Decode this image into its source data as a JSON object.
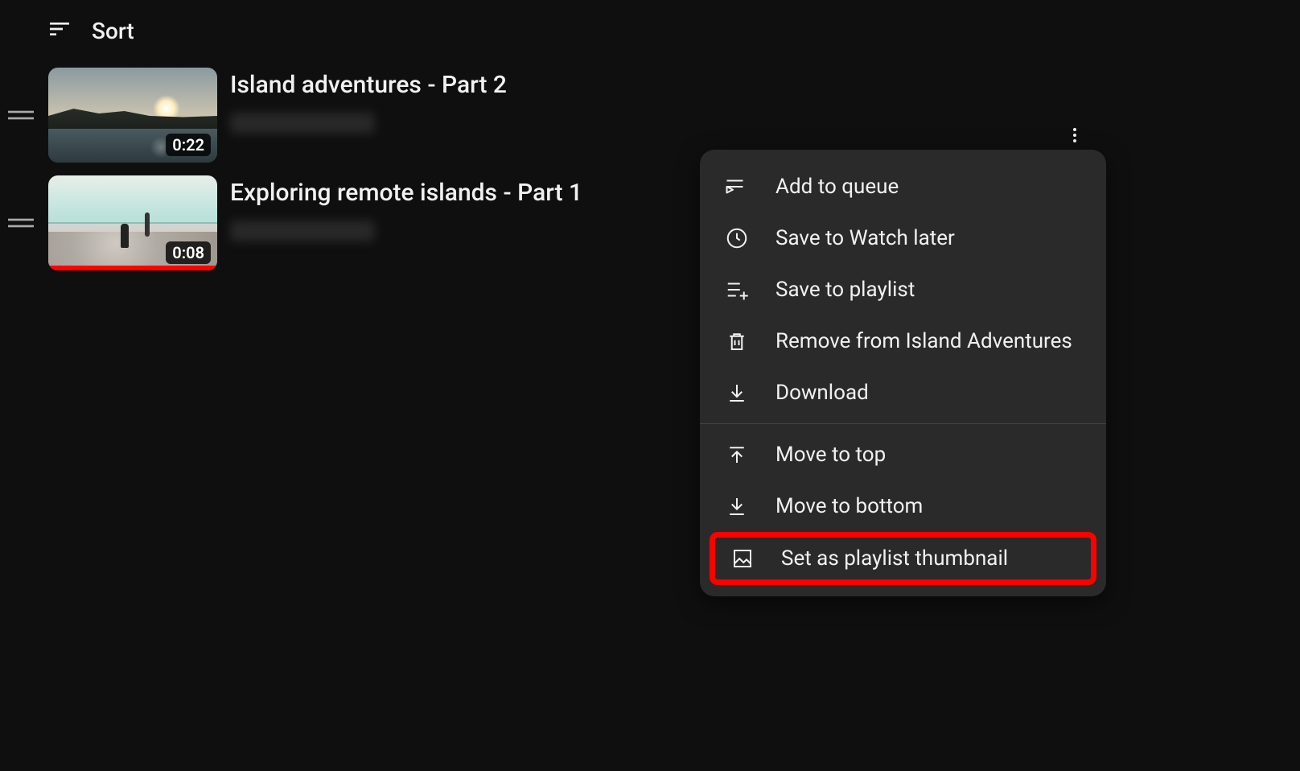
{
  "header": {
    "sort_label": "Sort"
  },
  "videos": [
    {
      "title": "Island adventures - Part 2",
      "duration": "0:22",
      "progress_pct": 0
    },
    {
      "title": "Exploring remote islands - Part 1",
      "duration": "0:08",
      "progress_pct": 100
    }
  ],
  "menu": {
    "items_top": [
      {
        "icon": "queue-play-icon",
        "label": "Add to queue"
      },
      {
        "icon": "clock-icon",
        "label": "Save to Watch later"
      },
      {
        "icon": "playlist-add-icon",
        "label": "Save to playlist"
      },
      {
        "icon": "trash-icon",
        "label": "Remove from Island Adventures"
      },
      {
        "icon": "download-icon",
        "label": "Download"
      }
    ],
    "items_bottom": [
      {
        "icon": "arrow-top-icon",
        "label": "Move to top"
      },
      {
        "icon": "arrow-bottom-icon",
        "label": "Move to bottom"
      },
      {
        "icon": "image-icon",
        "label": "Set as playlist thumbnail",
        "highlighted": true
      }
    ]
  }
}
